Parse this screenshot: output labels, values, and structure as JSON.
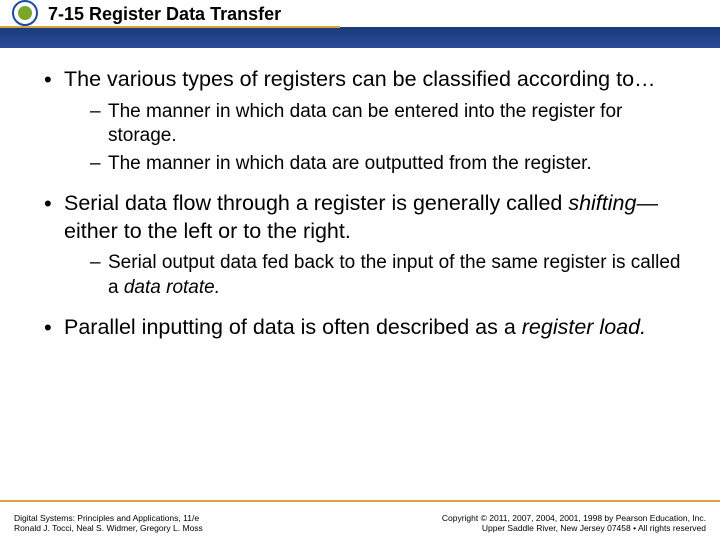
{
  "header": {
    "title": "7-15 Register Data Transfer"
  },
  "bullets": {
    "b1_lead": "The various types of registers can be classified according to…",
    "b1_sub1": "The manner in which data can be entered into the register for storage.",
    "b1_sub2": "The manner in which data are outputted from the register.",
    "b2_part1": "Serial data flow through a register is generally called ",
    "b2_ital": "shifting",
    "b2_part2": "—either to the left or to the right.",
    "b2_sub1_part1": "Serial output data fed back to the input of the same register is called a ",
    "b2_sub1_ital": "data rotate.",
    "b3_part1": "Parallel inputting of data is often described as a ",
    "b3_ital": "register load."
  },
  "footer": {
    "left_line1": "Digital Systems: Principles and Applications, 11/e",
    "left_line2": "Ronald J. Tocci, Neal S. Widmer, Gregory L. Moss",
    "right_line1": "Copyright © 2011, 2007, 2004, 2001, 1998 by Pearson Education, Inc.",
    "right_line2": "Upper Saddle River, New Jersey 07458 • All rights reserved"
  }
}
